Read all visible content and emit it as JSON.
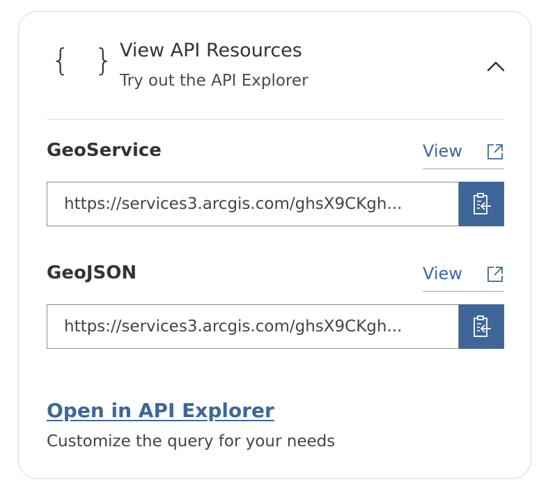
{
  "header": {
    "icon": "curly-braces-icon",
    "braces": "{ }",
    "title": "View API Resources",
    "subtitle": "Try out the API Explorer",
    "toggle_icon": "chevron-up-icon"
  },
  "resources": [
    {
      "title": "GeoService",
      "view_label": "View",
      "view_icon": "external-link-icon",
      "url": "https://services3.arcgis.com/ghsX9CKgh...",
      "copy_icon": "copy-clipboard-icon"
    },
    {
      "title": "GeoJSON",
      "view_label": "View",
      "view_icon": "external-link-icon",
      "url": "https://services3.arcgis.com/ghsX9CKgh...",
      "copy_icon": "copy-clipboard-icon"
    }
  ],
  "explorer": {
    "link_label": "Open in API Explorer",
    "description": "Customize the query for your needs"
  },
  "colors": {
    "accent": "#3e6698",
    "text": "#333333",
    "border": "#d6d6d6"
  }
}
